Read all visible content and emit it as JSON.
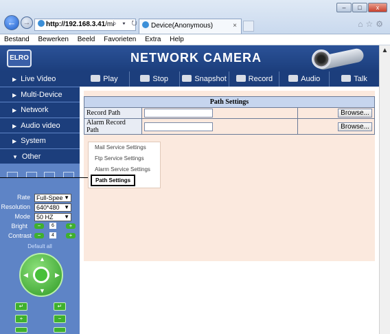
{
  "browser": {
    "address_host": "http://192.168.3.41",
    "address_rest": "/mi",
    "address_controls": "⌕ ▾ ↻",
    "tab_title": "Device(Anonymous)",
    "tab_close": "×",
    "window_buttons": [
      "–",
      "□",
      "x"
    ],
    "menu": [
      "Bestand",
      "Bewerken",
      "Beeld",
      "Favorieten",
      "Extra",
      "Help"
    ]
  },
  "banner": {
    "logo": "ELRO",
    "title": "NETWORK CAMERA"
  },
  "toolbar": [
    "Play",
    "Stop",
    "Snapshot",
    "Record",
    "Audio",
    "Talk"
  ],
  "sidebar": {
    "items": [
      {
        "label": "Live Video",
        "arrow": "▶"
      },
      {
        "label": "Multi-Device",
        "arrow": "▶"
      },
      {
        "label": "Network",
        "arrow": "▶"
      },
      {
        "label": "Audio video",
        "arrow": "▶"
      },
      {
        "label": "System",
        "arrow": "▶"
      },
      {
        "label": "Other",
        "arrow": "▼"
      }
    ],
    "controls": {
      "rate_label": "Rate",
      "rate_value": "Full-Spee",
      "resolution_label": "Resolution",
      "resolution_value": "640*480",
      "mode_label": "Mode",
      "mode_value": "50 HZ",
      "bright_label": "Bright",
      "bright_value": "6",
      "contrast_label": "Contrast",
      "contrast_value": "4",
      "default_all": "Default all"
    }
  },
  "path_settings": {
    "title": "Path Settings",
    "rows": [
      {
        "label": "Record Path",
        "value": "",
        "button": "Browse..."
      },
      {
        "label": "Alarm Record Path",
        "value": "",
        "button": "Browse..."
      }
    ]
  },
  "other_menu": {
    "items": [
      "Mail Service Settings",
      "Ftp Service Settings",
      "Alarm Service Settings",
      "Path Settings"
    ],
    "selected": "Path Settings"
  }
}
